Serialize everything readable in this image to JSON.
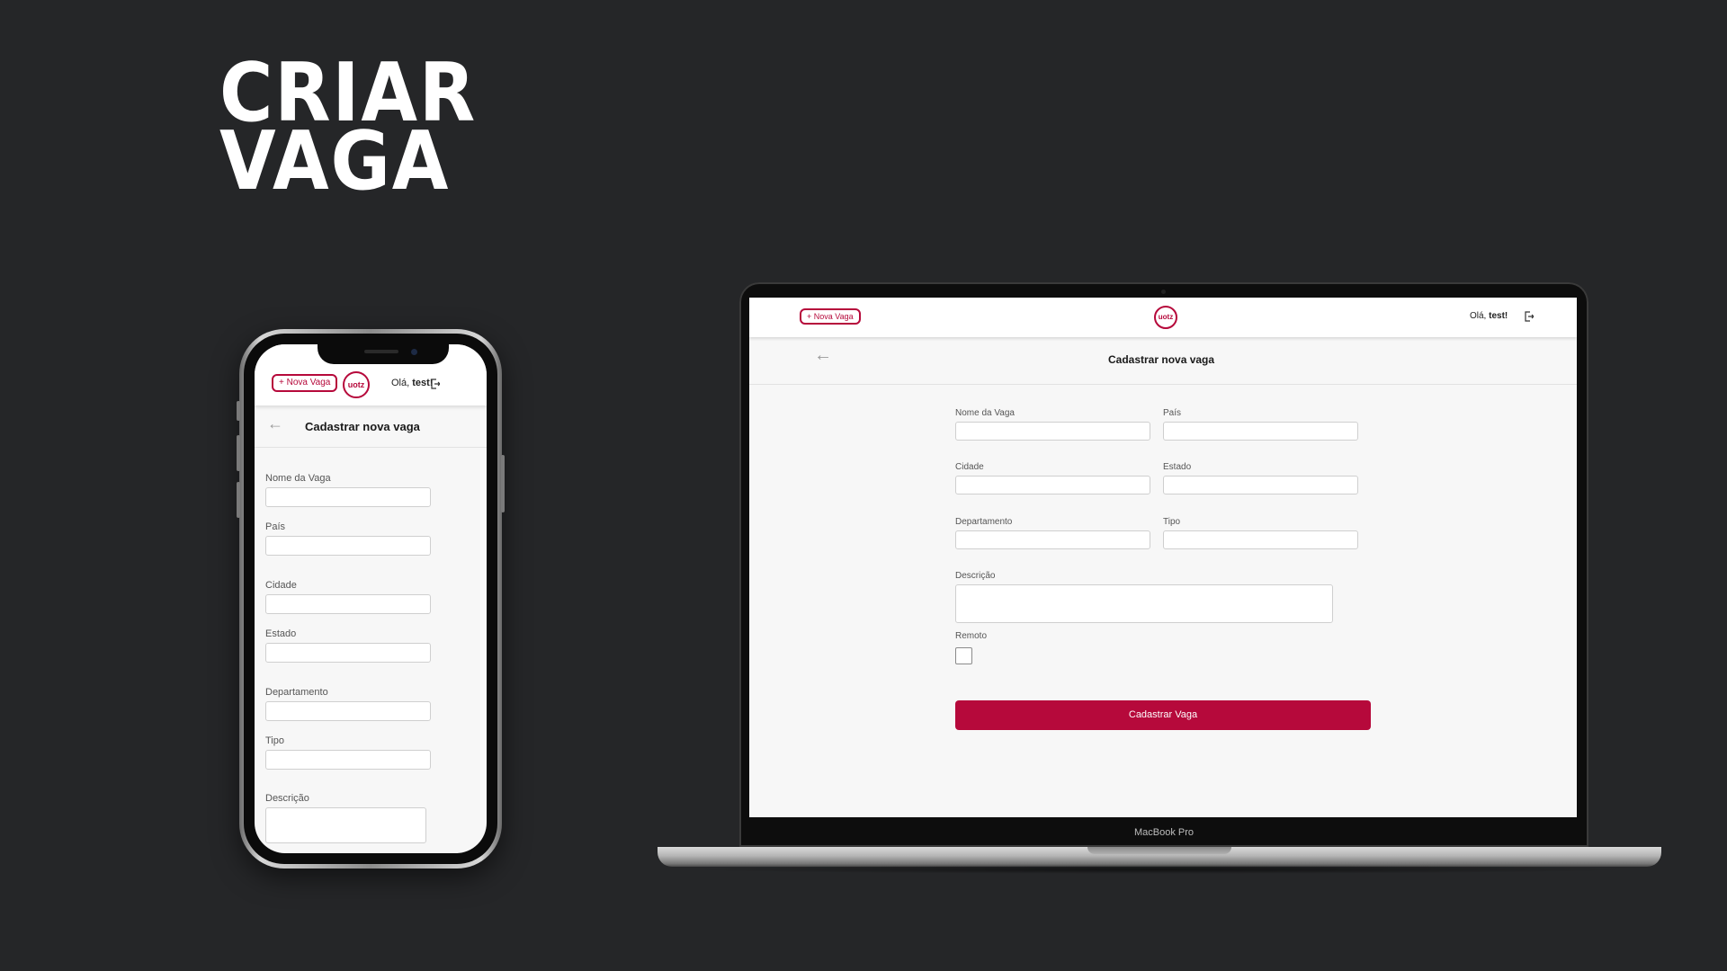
{
  "hero": {
    "line1": "CRIAR",
    "line2": "VAGA"
  },
  "header": {
    "new_job_button": "+ Nova Vaga",
    "logo_text": "uotz",
    "greeting": "Olá,",
    "username": "test!"
  },
  "page": {
    "title": "Cadastrar nova vaga"
  },
  "form": {
    "job_name_label": "Nome da Vaga",
    "country_label": "País",
    "city_label": "Cidade",
    "state_label": "Estado",
    "department_label": "Departamento",
    "type_label": "Tipo",
    "description_label": "Descrição",
    "remote_label": "Remoto",
    "submit_label": "Cadastrar Vaga"
  },
  "device": {
    "laptop_brand": "MacBook Pro"
  },
  "colors": {
    "accent": "#b6093b",
    "background": "#252628",
    "page_bg": "#f7f7f7"
  }
}
